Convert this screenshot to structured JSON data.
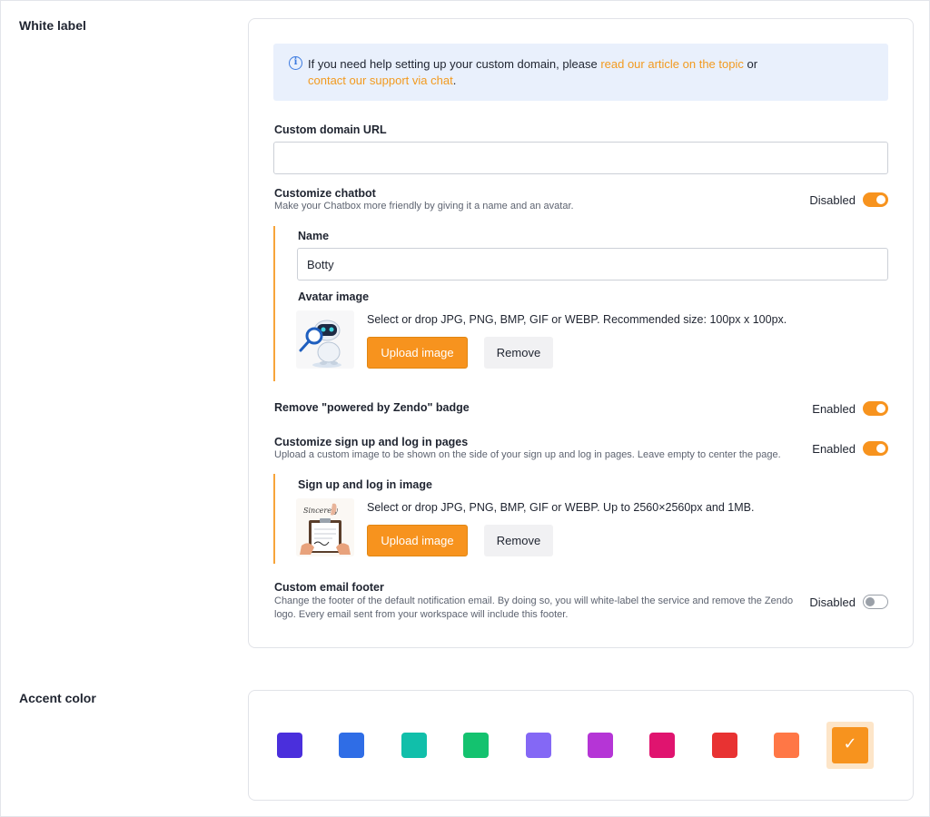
{
  "white_label": {
    "title": "White label",
    "info": {
      "text_before": "If you need help setting up your custom domain, please ",
      "link_article": "read our article on the topic",
      "text_middle": " or",
      "link_support": "contact our support via chat",
      "text_after": "."
    },
    "custom_domain": {
      "label": "Custom domain URL",
      "value": "",
      "placeholder": ""
    },
    "customize_chatbot": {
      "label": "Customize chatbot",
      "description": "Make your Chatbox more friendly by giving it a name and an avatar.",
      "toggle_label": "Disabled",
      "toggle_on": true
    },
    "chatbot_name": {
      "label": "Name",
      "value": "Botty"
    },
    "avatar_image": {
      "label": "Avatar image",
      "hint": "Select or drop JPG, PNG, BMP, GIF or WEBP. Recommended size: 100px x 100px.",
      "upload_label": "Upload image",
      "remove_label": "Remove"
    },
    "powered_badge": {
      "label": "Remove \"powered by Zendo\" badge",
      "toggle_label": "Enabled",
      "toggle_on": true
    },
    "signup_pages": {
      "label": "Customize sign up and log in pages",
      "description": "Upload a custom image to be shown on the side of your sign up and log in pages. Leave empty to center the page.",
      "toggle_label": "Enabled",
      "toggle_on": true
    },
    "signup_image": {
      "label": "Sign up and log in image",
      "hint": "Select or drop JPG, PNG, BMP, GIF or WEBP. Up to 2560×2560px and 1MB.",
      "upload_label": "Upload image",
      "remove_label": "Remove",
      "thumb_text": "Sincerely"
    },
    "email_footer": {
      "label": "Custom email footer",
      "description_line1": "Change the footer of the default notification email. By doing so, you will white-label the service and remove the Zendo",
      "description_line2": "logo. Every email sent from your workspace will include this footer.",
      "toggle_label": "Disabled",
      "toggle_on": false
    }
  },
  "accent_color": {
    "title": "Accent color",
    "selected_index": 9,
    "swatches": [
      "#4a2fdc",
      "#2f6de6",
      "#11bfaa",
      "#14c26f",
      "#8468f5",
      "#b535d6",
      "#e0146f",
      "#e83232",
      "#ff7746",
      "#f7931e"
    ]
  }
}
